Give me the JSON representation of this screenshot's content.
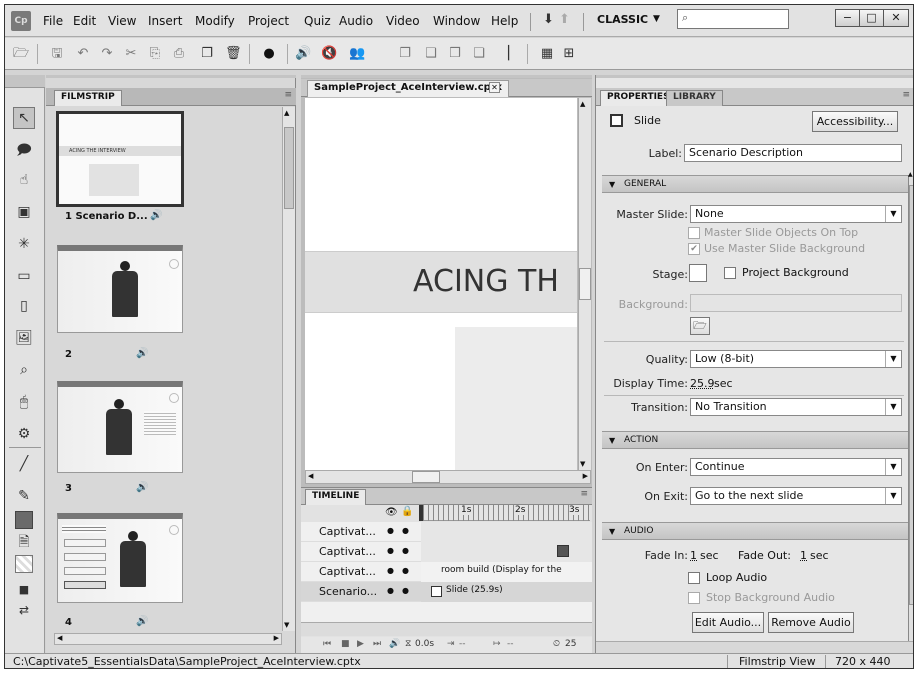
{
  "menu": {
    "logo": "Cp",
    "items": [
      "File",
      "Edit",
      "View",
      "Insert",
      "Modify",
      "Project",
      "Quiz",
      "Audio",
      "Video",
      "Window",
      "Help"
    ],
    "workspace": "CLASSIC",
    "search_placeholder": "⌕"
  },
  "filmstrip": {
    "tab": "FILMSTRIP",
    "slides": [
      {
        "label": "1 Scenario D...",
        "thumb_title": "ACING THE INTERVIEW"
      },
      {
        "label": "2"
      },
      {
        "label": "3"
      },
      {
        "label": "4"
      }
    ]
  },
  "stage": {
    "tab": "SampleProject_AceInterview.cptx",
    "slide_title": "ACING TH"
  },
  "timeline": {
    "tab": "TIMELINE",
    "rows": [
      "Captivat...",
      "Captivat...",
      "Captivat...",
      "Scenario..."
    ],
    "ruler": [
      "1s",
      "2s",
      "3s"
    ],
    "bar_text": "room build (Display for the",
    "slide_bar": "Slide (25.9s)",
    "controls": {
      "time": "0.0s",
      "in": "--",
      "span": "--",
      "fps": "25"
    }
  },
  "properties": {
    "tabs": [
      "PROPERTIES",
      "LIBRARY"
    ],
    "object_type": "Slide",
    "accessibility_button": "Accessibility...",
    "label_caption": "Label:",
    "label_value": "Scenario Description",
    "general": {
      "header": "GENERAL",
      "master_slide_label": "Master Slide:",
      "master_slide_value": "None",
      "master_objects_on_top": "Master Slide Objects On Top",
      "use_master_background": "Use Master Slide Background",
      "stage_label": "Stage:",
      "project_background": "Project Background",
      "background_label": "Background:",
      "quality_label": "Quality:",
      "quality_value": "Low (8-bit)",
      "display_time_label": "Display Time:",
      "display_time_value": "25.9",
      "display_time_unit": "sec",
      "transition_label": "Transition:",
      "transition_value": "No Transition"
    },
    "action": {
      "header": "ACTION",
      "on_enter_label": "On Enter:",
      "on_enter_value": "Continue",
      "on_exit_label": "On Exit:",
      "on_exit_value": "Go to the next slide"
    },
    "audio": {
      "header": "AUDIO",
      "fade_in_label": "Fade In:",
      "fade_in_value": "1",
      "fade_out_label": "Fade Out:",
      "fade_out_value": "1",
      "unit": "sec",
      "loop_audio": "Loop Audio",
      "stop_background_audio": "Stop Background Audio",
      "edit_button": "Edit Audio...",
      "remove_button": "Remove Audio"
    }
  },
  "status": {
    "path": "C:\\Captivate5_EssentialsData\\SampleProject_AceInterview.cptx",
    "view": "Filmstrip View",
    "size": "720 x 440"
  }
}
